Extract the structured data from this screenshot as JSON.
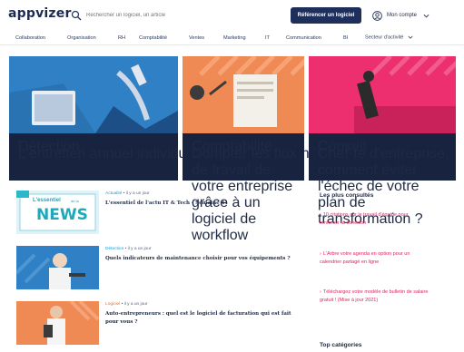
{
  "header": {
    "logo": "appvizer",
    "search_placeholder": "Rechercher un logiciel, un article",
    "reference_button": "Référencer un logiciel",
    "account_label": "Mon compte"
  },
  "nav": {
    "items": [
      "Collaboration",
      "Organisation",
      "RH",
      "Comptabilité",
      "Ventes",
      "Marketing",
      "IT",
      "Communication",
      "BI",
      "Secteur d'activité"
    ]
  },
  "colors": {
    "navy": "#1f2f5c",
    "hero_blue": "#2f80c5",
    "hero_orange": "#f08a54",
    "hero_pink": "#ee2f6f",
    "link_pink": "#e0245e"
  },
  "hero": [
    {
      "category": "Détection",
      "title": "L'entretien annuel individuel : obligatoire ou non ?"
    },
    {
      "category": "Comptabilité",
      "title": "Dompter les flux de travail de votre entreprise grâce à un logiciel de workflow"
    },
    {
      "category": "Conseil",
      "title": "Chef·fe d'entreprise, comment éviter l'échec de votre plan de transformation ?"
    }
  ],
  "articles": [
    {
      "tag": "Actualité",
      "time": "il y a un jour",
      "title": "L'essentiel de l'actu IT & Tech - Semaine 41",
      "thumb_text_1": "L'essentiel",
      "thumb_text_2": "NEWS",
      "thumb_text_3": "de la"
    },
    {
      "tag": "Détection",
      "time": "il y a un jour",
      "title": "Quels indicateurs de maintenance choisir pour vos équipements ?"
    },
    {
      "tag": "Logiciel",
      "time": "il y a un jour",
      "title": "Auto-entrepreneurs : quel est le logiciel de facturation qui est fait pour vous ?"
    }
  ],
  "sidebar": {
    "heading": "Les plus consultés",
    "links": [
      "10 citations sur le travail d'équipe pour renforcer la cohésion",
      "L'Arbre votre agenda en option pour un calendrier partagé en ligne",
      "Téléchargez votre modèle de bulletin de salaire gratuit ! (Mise à jour 2021)"
    ],
    "heading2": "Top catégories"
  }
}
